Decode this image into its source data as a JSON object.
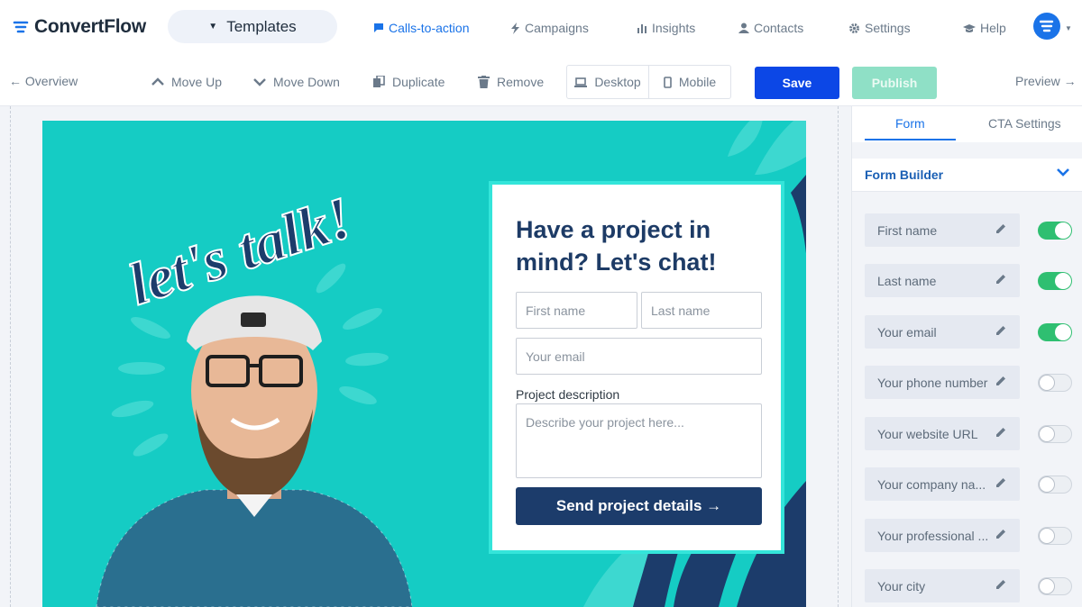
{
  "app": {
    "name": "ConvertFlow",
    "templates_label": "Templates"
  },
  "nav": {
    "items": [
      {
        "label": "Calls-to-action",
        "icon": "chat-icon",
        "active": true
      },
      {
        "label": "Campaigns",
        "icon": "bolt-icon",
        "active": false
      },
      {
        "label": "Insights",
        "icon": "bar-chart-icon",
        "active": false
      },
      {
        "label": "Contacts",
        "icon": "user-icon",
        "active": false
      },
      {
        "label": "Settings",
        "icon": "gear-icon",
        "active": false
      },
      {
        "label": "Help",
        "icon": "graduation-cap-icon",
        "active": false
      }
    ]
  },
  "toolbar": {
    "overview": "← Overview",
    "move_up": "Move Up",
    "move_down": "Move Down",
    "duplicate": "Duplicate",
    "remove": "Remove",
    "desktop": "Desktop",
    "mobile": "Mobile",
    "save": "Save",
    "publish": "Publish",
    "preview": "Preview →"
  },
  "cta": {
    "headline": "let's talk!",
    "form": {
      "heading": "Have a project in mind? Let's chat!",
      "first_name_placeholder": "First name",
      "last_name_placeholder": "Last name",
      "email_placeholder": "Your email",
      "description_label": "Project description",
      "description_placeholder": "Describe your project here...",
      "submit_label": "Send project details →"
    }
  },
  "panel": {
    "tabs": [
      {
        "label": "Form",
        "active": true
      },
      {
        "label": "CTA Settings",
        "active": false
      }
    ],
    "builder_title": "Form Builder",
    "fields": [
      {
        "label": "First name",
        "enabled": true
      },
      {
        "label": "Last name",
        "enabled": true
      },
      {
        "label": "Your email",
        "enabled": true
      },
      {
        "label": "Your phone number",
        "enabled": false
      },
      {
        "label": "Your website URL",
        "enabled": false
      },
      {
        "label": "Your company na...",
        "enabled": false
      },
      {
        "label": "Your professional ...",
        "enabled": false
      },
      {
        "label": "Your city",
        "enabled": false
      }
    ]
  },
  "colors": {
    "accent": "#1a73e8",
    "save": "#0c47e6",
    "publish": "#8fe0c6",
    "cta_background": "#15ccc4",
    "form_border": "#34e5da",
    "submit": "#1c3c6b",
    "toggle_on": "#2fbf71"
  }
}
